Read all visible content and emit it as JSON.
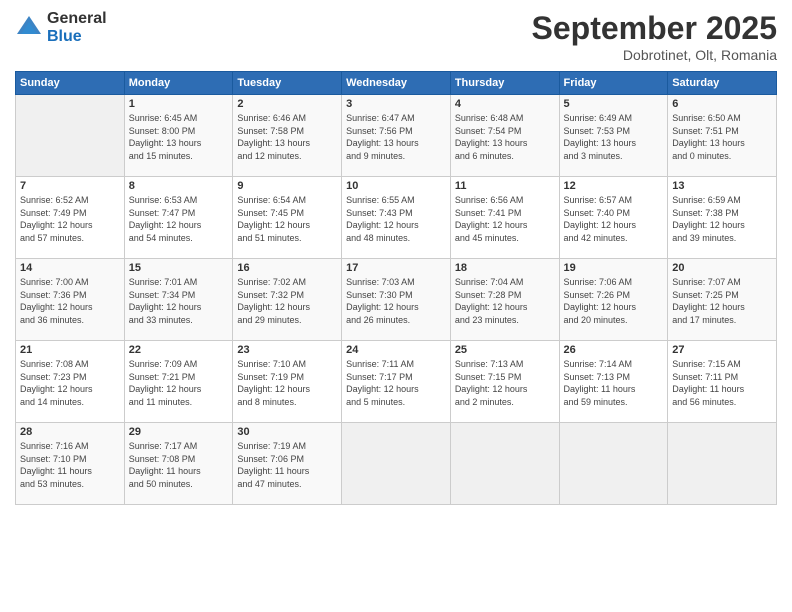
{
  "header": {
    "logo_general": "General",
    "logo_blue": "Blue",
    "month_title": "September 2025",
    "location": "Dobrotinet, Olt, Romania"
  },
  "days_of_week": [
    "Sunday",
    "Monday",
    "Tuesday",
    "Wednesday",
    "Thursday",
    "Friday",
    "Saturday"
  ],
  "weeks": [
    [
      {
        "day": "",
        "info": ""
      },
      {
        "day": "1",
        "info": "Sunrise: 6:45 AM\nSunset: 8:00 PM\nDaylight: 13 hours\nand 15 minutes."
      },
      {
        "day": "2",
        "info": "Sunrise: 6:46 AM\nSunset: 7:58 PM\nDaylight: 13 hours\nand 12 minutes."
      },
      {
        "day": "3",
        "info": "Sunrise: 6:47 AM\nSunset: 7:56 PM\nDaylight: 13 hours\nand 9 minutes."
      },
      {
        "day": "4",
        "info": "Sunrise: 6:48 AM\nSunset: 7:54 PM\nDaylight: 13 hours\nand 6 minutes."
      },
      {
        "day": "5",
        "info": "Sunrise: 6:49 AM\nSunset: 7:53 PM\nDaylight: 13 hours\nand 3 minutes."
      },
      {
        "day": "6",
        "info": "Sunrise: 6:50 AM\nSunset: 7:51 PM\nDaylight: 13 hours\nand 0 minutes."
      }
    ],
    [
      {
        "day": "7",
        "info": "Sunrise: 6:52 AM\nSunset: 7:49 PM\nDaylight: 12 hours\nand 57 minutes."
      },
      {
        "day": "8",
        "info": "Sunrise: 6:53 AM\nSunset: 7:47 PM\nDaylight: 12 hours\nand 54 minutes."
      },
      {
        "day": "9",
        "info": "Sunrise: 6:54 AM\nSunset: 7:45 PM\nDaylight: 12 hours\nand 51 minutes."
      },
      {
        "day": "10",
        "info": "Sunrise: 6:55 AM\nSunset: 7:43 PM\nDaylight: 12 hours\nand 48 minutes."
      },
      {
        "day": "11",
        "info": "Sunrise: 6:56 AM\nSunset: 7:41 PM\nDaylight: 12 hours\nand 45 minutes."
      },
      {
        "day": "12",
        "info": "Sunrise: 6:57 AM\nSunset: 7:40 PM\nDaylight: 12 hours\nand 42 minutes."
      },
      {
        "day": "13",
        "info": "Sunrise: 6:59 AM\nSunset: 7:38 PM\nDaylight: 12 hours\nand 39 minutes."
      }
    ],
    [
      {
        "day": "14",
        "info": "Sunrise: 7:00 AM\nSunset: 7:36 PM\nDaylight: 12 hours\nand 36 minutes."
      },
      {
        "day": "15",
        "info": "Sunrise: 7:01 AM\nSunset: 7:34 PM\nDaylight: 12 hours\nand 33 minutes."
      },
      {
        "day": "16",
        "info": "Sunrise: 7:02 AM\nSunset: 7:32 PM\nDaylight: 12 hours\nand 29 minutes."
      },
      {
        "day": "17",
        "info": "Sunrise: 7:03 AM\nSunset: 7:30 PM\nDaylight: 12 hours\nand 26 minutes."
      },
      {
        "day": "18",
        "info": "Sunrise: 7:04 AM\nSunset: 7:28 PM\nDaylight: 12 hours\nand 23 minutes."
      },
      {
        "day": "19",
        "info": "Sunrise: 7:06 AM\nSunset: 7:26 PM\nDaylight: 12 hours\nand 20 minutes."
      },
      {
        "day": "20",
        "info": "Sunrise: 7:07 AM\nSunset: 7:25 PM\nDaylight: 12 hours\nand 17 minutes."
      }
    ],
    [
      {
        "day": "21",
        "info": "Sunrise: 7:08 AM\nSunset: 7:23 PM\nDaylight: 12 hours\nand 14 minutes."
      },
      {
        "day": "22",
        "info": "Sunrise: 7:09 AM\nSunset: 7:21 PM\nDaylight: 12 hours\nand 11 minutes."
      },
      {
        "day": "23",
        "info": "Sunrise: 7:10 AM\nSunset: 7:19 PM\nDaylight: 12 hours\nand 8 minutes."
      },
      {
        "day": "24",
        "info": "Sunrise: 7:11 AM\nSunset: 7:17 PM\nDaylight: 12 hours\nand 5 minutes."
      },
      {
        "day": "25",
        "info": "Sunrise: 7:13 AM\nSunset: 7:15 PM\nDaylight: 12 hours\nand 2 minutes."
      },
      {
        "day": "26",
        "info": "Sunrise: 7:14 AM\nSunset: 7:13 PM\nDaylight: 11 hours\nand 59 minutes."
      },
      {
        "day": "27",
        "info": "Sunrise: 7:15 AM\nSunset: 7:11 PM\nDaylight: 11 hours\nand 56 minutes."
      }
    ],
    [
      {
        "day": "28",
        "info": "Sunrise: 7:16 AM\nSunset: 7:10 PM\nDaylight: 11 hours\nand 53 minutes."
      },
      {
        "day": "29",
        "info": "Sunrise: 7:17 AM\nSunset: 7:08 PM\nDaylight: 11 hours\nand 50 minutes."
      },
      {
        "day": "30",
        "info": "Sunrise: 7:19 AM\nSunset: 7:06 PM\nDaylight: 11 hours\nand 47 minutes."
      },
      {
        "day": "",
        "info": ""
      },
      {
        "day": "",
        "info": ""
      },
      {
        "day": "",
        "info": ""
      },
      {
        "day": "",
        "info": ""
      }
    ]
  ]
}
